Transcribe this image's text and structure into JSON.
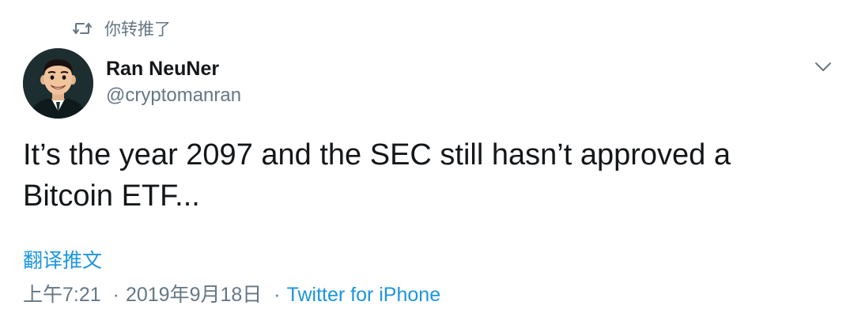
{
  "retweet_context": {
    "icon": "retweet-icon",
    "label": "你转推了"
  },
  "author": {
    "display_name": "Ran NeuNer",
    "handle": "@cryptomanran",
    "avatar_icon": "avatar-illustration"
  },
  "menu": {
    "icon": "chevron-down-icon"
  },
  "tweet": {
    "text": "It’s the year 2097 and the SEC still hasn’t approved a Bitcoin ETF..."
  },
  "translate": {
    "label": "翻译推文"
  },
  "meta": {
    "time": "上午7:21",
    "date": "2019年9月18日",
    "separator": "·",
    "source": "Twitter for iPhone"
  },
  "colors": {
    "link": "#1b95e0",
    "secondary_text": "#657786",
    "primary_text": "#14171a"
  }
}
